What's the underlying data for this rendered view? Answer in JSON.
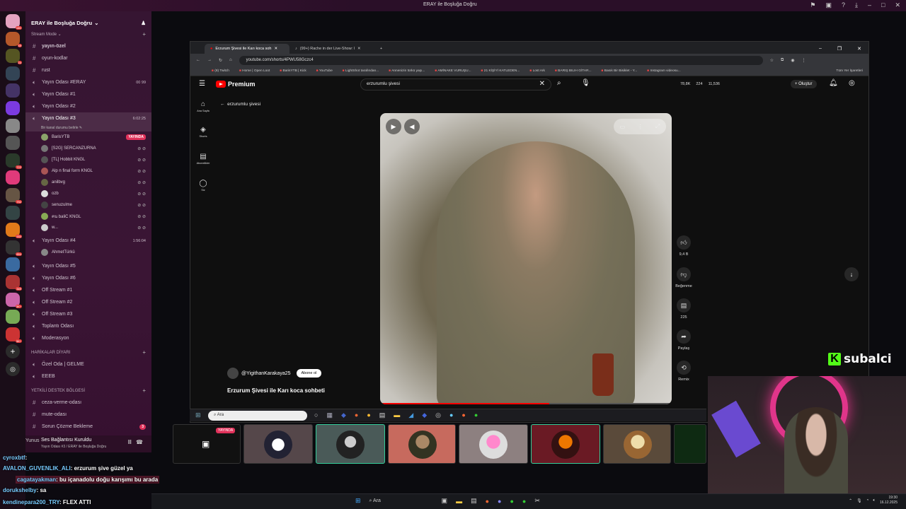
{
  "window_title": "ERAY ile Boşluğa Doğru",
  "server": {
    "name": "ERAY ile Boşluğa Doğru",
    "rail_counts": [
      "16K",
      "49",
      "24",
      "722",
      "792",
      "934",
      "894",
      "349",
      "3K+",
      "3K+"
    ]
  },
  "channels": {
    "cat_stream": "Stream Mode",
    "rows": [
      {
        "name": "yayın-özel",
        "kind": "text",
        "bold": true
      },
      {
        "name": "oyun-kodlar",
        "kind": "text"
      },
      {
        "name": "rust",
        "kind": "text"
      },
      {
        "name": "Yayın Odası #ERAY",
        "kind": "voice",
        "badge": "00 99"
      },
      {
        "name": "Yayın Odası #1",
        "kind": "voice"
      },
      {
        "name": "Yayın Odası #2",
        "kind": "voice"
      },
      {
        "name": "Yayın Odası #3",
        "kind": "voice",
        "sel": true,
        "time": "6:02:25"
      }
    ],
    "status_note": "Bir kanal durumu belirle",
    "users_r3": [
      {
        "name": "BarisYTB",
        "live": "YAYINDA",
        "color": "#8ba36a"
      },
      {
        "name": "[S2G] SERCANZURNA",
        "color": "#777"
      },
      {
        "name": "[TL] Hobbit  KNGL",
        "color": "#555"
      },
      {
        "name": "Alp n final form  KNGL",
        "color": "#a55"
      },
      {
        "name": "anilbvg",
        "color": "#664"
      },
      {
        "name": "ozb",
        "color": "#ddd"
      },
      {
        "name": "senuzulme",
        "color": "#444"
      },
      {
        "name": "คน baliC  KNGL",
        "color": "#8a5"
      },
      {
        "name": "w...",
        "color": "#ccc"
      }
    ],
    "r4": {
      "name": "Yayın Odası #4",
      "time": "1:56:04",
      "user": "AhmetTürkü"
    },
    "rows2": [
      "Yayın Odası #5",
      "Yayın Odası #6",
      "Off Stream #1",
      "Off Stream #2",
      "Off Stream #3",
      "Toplantı Odası",
      "Moderasyon"
    ],
    "cat_harikalar": "HARİKALAR DİYARI",
    "rows3": [
      "Özel Oda | GELME",
      "EEEB"
    ],
    "cat_yetkili": "YETKİLİ DESTEK BÖLGESİ",
    "rows4": [
      "ceza-verme-odası",
      "mute-odası",
      "Sorun Çözme Bekleme"
    ],
    "rows4_badge": "3",
    "conn": "Ses Bağlantısı Kuruldu",
    "conn_sub": "Yayın Odası #3 / ERAY ile Boşluğa Doğru",
    "user_short": "Yunus"
  },
  "browser": {
    "tab1": "Erzurum Şivesi ile Karı koca soh",
    "tab2": "(99+) Rache in der Live-Show: l",
    "url": "youtube.com/shorts/4PWU58Gczc4",
    "bookmarks": [
      "(8) Twitch",
      "Home | Open Loot",
      "BarisYTB | Kick",
      "YouTube",
      "LightShot tarafından...",
      "Annenizin türkü yaşı...",
      "AMİNAKE VURUŞU...",
      "21 KİŞİYİ KATLEDEN...",
      "Lost Ark",
      "BARIŞ BILIH GİTAR...",
      "Basık Bir Bisiklet - Y...",
      "Instagram videosu..."
    ],
    "bookmarks_more": "Tüm Yer İşaretleri"
  },
  "youtube": {
    "premium": "Premium",
    "search_value": "erzurumlu şivesi",
    "back_label": "erzurumlu şivesi",
    "stats": [
      "78,8K",
      "224",
      "11,536"
    ],
    "create": "Oluştur",
    "nav": [
      "Ana Sayfa",
      "Shorts",
      "Abonelikler",
      "Siz"
    ],
    "channel": "@YigithanKarakaya25",
    "subscribe": "Abone ol",
    "video_title": "Erzurum Şivesi ile Karı koca sohbeti",
    "likes": "9,4 B",
    "dislike": "Beğenme",
    "comments": "225",
    "share": "Paylaş",
    "remix": "Remix"
  },
  "overlay": {
    "kick_text": "subalci"
  },
  "intaskbar_search": "Ara",
  "cam_live": "YAYINDA",
  "chat": [
    {
      "user": "AVALON_GUVENLIK_ALI",
      "text": ": erzurum şive güzel ya"
    },
    {
      "user": "cagatayakman",
      "text": ": bu içanadolu doğu karışımı bu arada"
    },
    {
      "user": "dorukshelby",
      "text": ": sa"
    },
    {
      "user": "cyroxbtf",
      "text": ":"
    },
    {
      "user": "kendinepara200_TRY",
      "text": ": FLEX ATTI"
    }
  ],
  "taskbar": {
    "search": "Ara",
    "time": "19:30",
    "date": "16.12.2025"
  },
  "colors": {
    "accent": "#e0315a",
    "yt_red": "#ff0000",
    "kick_green": "#53fc18"
  }
}
